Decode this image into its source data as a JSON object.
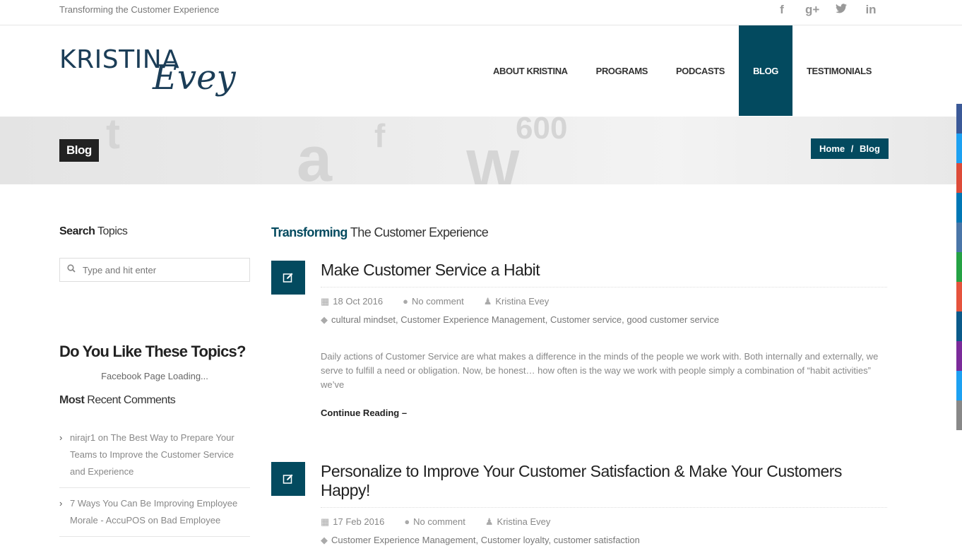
{
  "topbar": {
    "tagline": "Transforming the Customer Experience",
    "social": [
      {
        "icon": "facebook-icon",
        "glyph": "f"
      },
      {
        "icon": "google-plus-icon",
        "glyph": "g+"
      },
      {
        "icon": "twitter-icon",
        "glyph": "t"
      },
      {
        "icon": "linkedin-icon",
        "glyph": "in"
      }
    ]
  },
  "logo": {
    "line1": "KRISTINA",
    "line2": "Evey"
  },
  "nav": [
    {
      "label": "ABOUT KRISTINA",
      "active": false
    },
    {
      "label": "PROGRAMS",
      "active": false
    },
    {
      "label": "PODCASTS",
      "active": false
    },
    {
      "label": "BLOG",
      "active": true
    },
    {
      "label": "TESTIMONIALS",
      "active": false
    }
  ],
  "banner": {
    "page_title": "Blog",
    "breadcrumb": {
      "home": "Home",
      "separator": "/",
      "current": "Blog"
    }
  },
  "sidebar": {
    "search_title_bold": "Search",
    "search_title_rest": " Topics",
    "search_placeholder": "Type and hit enter",
    "like_title": "Do You Like These Topics?",
    "fb_loading": "Facebook Page Loading...",
    "recent_title_bold": "Most",
    "recent_title_rest": " Recent Comments",
    "recent_comments": [
      {
        "author": "nirajr1",
        "text": " on The Best Way to Prepare Your Teams to Improve the Customer Service and Experience"
      },
      {
        "author": "7 Ways You Can Be Improving Employee Morale - AccuPOS",
        "text": " on Bad Employee"
      }
    ]
  },
  "main": {
    "heading_bold": "Transforming",
    "heading_rest": " The Customer Experience",
    "posts": [
      {
        "title": "Make Customer Service a Habit",
        "date": "18 Oct 2016",
        "comments": "No comment",
        "author": "Kristina Evey",
        "tags": "cultural mindset, Customer Experience Management, Customer service, good customer service",
        "excerpt": "Daily actions of Customer Service are what makes a difference in the minds of the people we work with. Both internally and externally, we serve to fulfill a need or obligation. Now, be honest… how often is the way we work with people simply a combination of “habit activities” we’ve",
        "more": "Continue Reading –"
      },
      {
        "title": "Personalize to Improve Your Customer Satisfaction & Make Your Customers Happy!",
        "date": "17 Feb 2016",
        "comments": "No comment",
        "author": "Kristina Evey",
        "tags": "Customer Experience Management, Customer loyalty, customer satisfaction"
      }
    ]
  },
  "colors": {
    "accent": "#034a5f",
    "dark": "#222222",
    "share_bar": [
      "#3b5998",
      "#1da1f2",
      "#dd4b39",
      "#0077b5",
      "#4a76a8",
      "#25a244",
      "#e5533d",
      "#0b5a8a",
      "#7b2b9a",
      "#1da1f2",
      "#888888"
    ]
  }
}
